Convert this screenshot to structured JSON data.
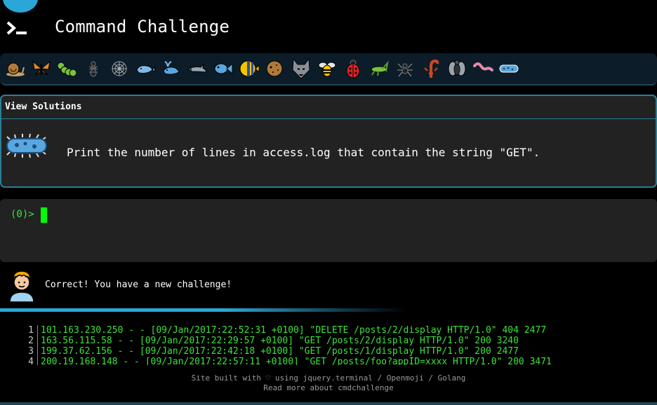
{
  "header": {
    "title": "Command Challenge"
  },
  "icons": [
    {
      "name": "snail-icon"
    },
    {
      "name": "butterfly-icon"
    },
    {
      "name": "caterpillar-icon"
    },
    {
      "name": "ant-icon"
    },
    {
      "name": "spider-web-icon"
    },
    {
      "name": "whale-icon"
    },
    {
      "name": "spouting-whale-icon"
    },
    {
      "name": "dolphin-icon"
    },
    {
      "name": "fish-icon"
    },
    {
      "name": "tropical-fish-icon"
    },
    {
      "name": "blowfish-icon"
    },
    {
      "name": "wolf-icon"
    },
    {
      "name": "bee-icon"
    },
    {
      "name": "ladybug-icon"
    },
    {
      "name": "cricket-icon"
    },
    {
      "name": "spider-icon"
    },
    {
      "name": "scorpion-icon"
    },
    {
      "name": "fly-icon"
    },
    {
      "name": "worm-icon"
    },
    {
      "name": "microbe-icon"
    }
  ],
  "challenge": {
    "view_solutions": "View Solutions",
    "prompt": "Print the number of lines in access.log that contain the string \"GET\"."
  },
  "terminal": {
    "prompt": "(0)>"
  },
  "feedback": {
    "message": "Correct! You have a new challenge!"
  },
  "file_view": {
    "lines": [
      {
        "n": "1",
        "text": "101.163.230.250 - - [09/Jan/2017:22:52:31 +0100] \"DELETE /posts/2/display HTTP/1.0\" 404 2477"
      },
      {
        "n": "2",
        "text": "163.56.115.58 - - [09/Jan/2017:22:29:57 +0100] \"GET /posts/2/display HTTP/1.0\" 200 3240"
      },
      {
        "n": "3",
        "text": "199.37.62.156 - - [09/Jan/2017:22:42:18 +0100] \"GET /posts/1/display HTTP/1.0\" 200 2477"
      },
      {
        "n": "4",
        "text": "200.19.168.148 - - [09/Jan/2017:22:57:11 +0100] \"GET /posts/foo?appID=xxxx HTTP/1.0\" 200 3471"
      }
    ]
  },
  "footer": {
    "line1": "Site built with ♡ using jquery.terminal / Openmoji / Golang",
    "line2": "Read more about cmdchallenge"
  },
  "colors": {
    "accent": "#2aa7d8",
    "terminal_green": "#3ce33c",
    "panel": "#222222"
  }
}
